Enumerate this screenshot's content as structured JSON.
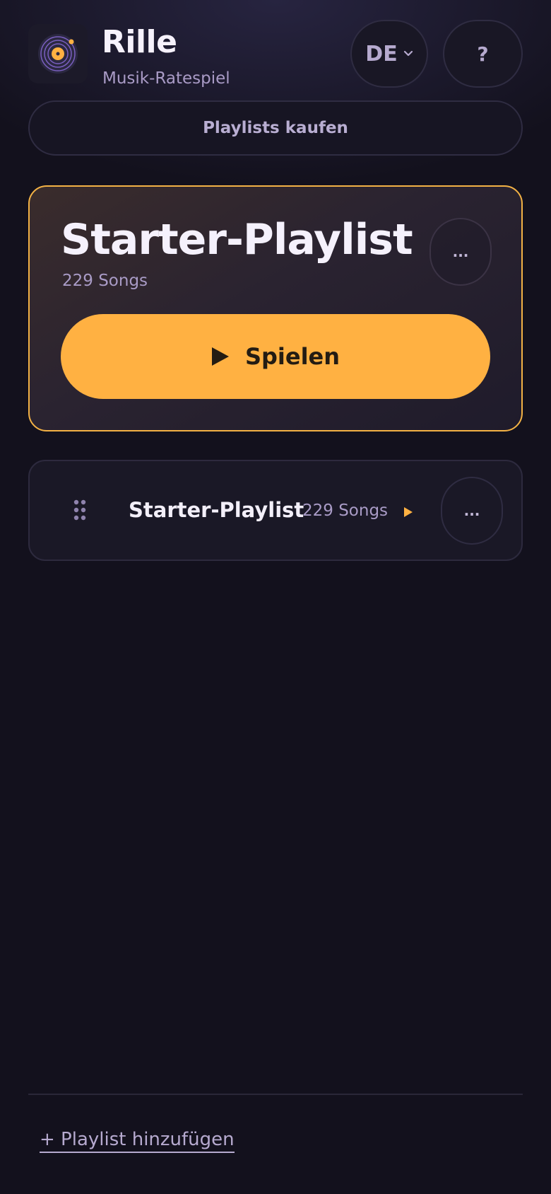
{
  "header": {
    "title": "Rille",
    "subtitle": "Musik-Ratespiel",
    "language": "DE",
    "help_label": "?"
  },
  "buy_button": {
    "label": "Playlists kaufen"
  },
  "featured": {
    "title": "Starter-Playlist",
    "count": "229 Songs",
    "more_label": "...",
    "play_label": "Spielen"
  },
  "playlists": [
    {
      "title": "Starter-Playlist",
      "count": "229 Songs",
      "more_label": "..."
    }
  ],
  "footer": {
    "add_label": "+ Playlist hinzufügen"
  },
  "colors": {
    "accent": "#ffb142",
    "background": "#13111d",
    "card": "#1a1826",
    "muted_text": "#a99bc6"
  },
  "icons": {
    "logo": "vinyl-record-icon",
    "language_chevron": "chevron-down-icon",
    "play": "play-icon",
    "drag": "drag-handle-icon"
  }
}
